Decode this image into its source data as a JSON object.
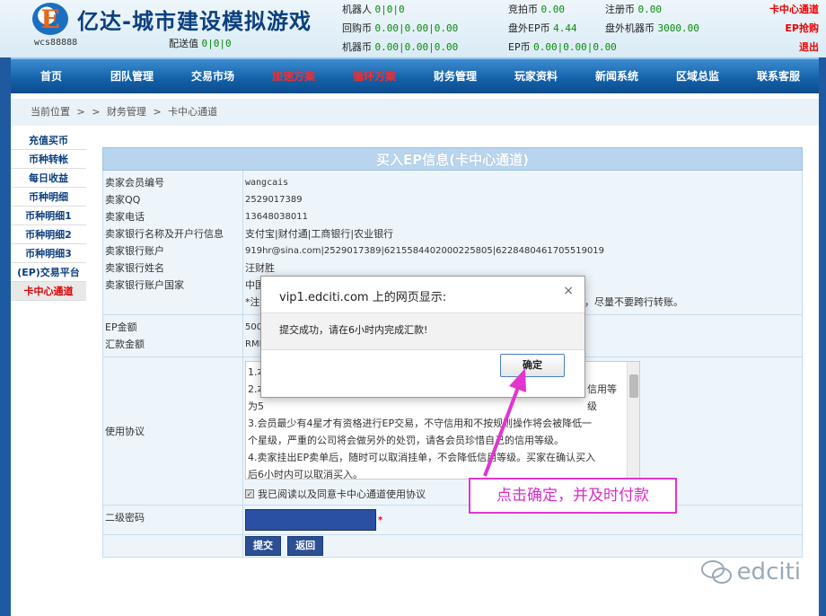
{
  "header": {
    "logo_letter": "E",
    "title": "亿达-城市建设模拟游戏",
    "username": "wcs88888",
    "stats": [
      {
        "label": "配送值",
        "value": "0|0|0"
      },
      {
        "label": "机器人",
        "value": "0|0|0"
      },
      {
        "label": "回购币",
        "value": "0.00|0.00|0.00"
      },
      {
        "label": "机器币",
        "value": "0.00|0.00|0.00"
      },
      {
        "label": "竞拍币",
        "value": "0.00"
      },
      {
        "label": "盘外EP币",
        "value": "4.44"
      },
      {
        "label": "EP币",
        "value": "0.00|0.00|0.00"
      },
      {
        "label": "注册币",
        "value": "0.00"
      },
      {
        "label": "盘外机器币",
        "value": "3000.00"
      }
    ],
    "links": {
      "card_channel": "卡中心通道",
      "ep_buy": "EP抢购",
      "logout": "退出"
    }
  },
  "nav": [
    "首页",
    "团队管理",
    "交易市场",
    "加速方案",
    "循环方案",
    "财务管理",
    "玩家资料",
    "新闻系统",
    "区域总监",
    "联系客服"
  ],
  "breadcrumb": {
    "root": "当前位置",
    "sep": ">",
    "finance": "财务管理",
    "current": "卡中心通道"
  },
  "sidebar": [
    "充值买币",
    "币种转帐",
    "每日收益",
    "币种明细",
    "币种明细1",
    "币种明细2",
    "币种明细3",
    "(EP)交易平台",
    "卡中心通道"
  ],
  "panel": {
    "title": "买入EP信息(卡中心通道)",
    "seller_labels": [
      "卖家会员编号",
      "卖家QQ",
      "卖家电话",
      "卖家银行名称及开户行信息",
      "卖家银行账户",
      "卖家银行姓名",
      "卖家银行账户国家"
    ],
    "seller_values": [
      "wangcais",
      "2529017389",
      "13648038011",
      "支付宝|财付通|工商银行|农业银行",
      "919hr@sina.com|2529017389|6215584402000225805|6228480461705519019",
      "汪财胜",
      "中国"
    ],
    "note": "*注",
    "note_right": "，尽量不要跨行转账。",
    "ep_label": "EP金额",
    "ep_value": "500",
    "remit_label": "汇款金额",
    "remit_value": "RMB",
    "protocol_label": "使用协议",
    "protocol_lines": [
      "1.本",
      "2.本",
      "为5",
      "3.会员最少有4星才有资格进行EP交易，不守信用和不按规则操作将会被降低一",
      "个星级，严重的公司将会做另外的处罚，请各会员珍惜自己的信用等级。",
      "4.卖家挂出EP卖单后，随时可以取消挂单，不会降低信用等级。买家在确认买入",
      "后6小时内可以取消买入。"
    ],
    "protocol_right": "信用等级",
    "agree": "我已阅读以及同意卡中心通道使用协议",
    "pwd_label": "二级密码",
    "required": "*",
    "submit": "提交",
    "back": "返回"
  },
  "dialog": {
    "title": "vip1.edciti.com 上的网页显示:",
    "close": "×",
    "message": "提交成功，请在6小时内完成汇款!",
    "ok": "确定"
  },
  "annotation": {
    "text": "点击确定，并及时付款",
    "color": "#e036cf"
  },
  "watermark": "edciti"
}
